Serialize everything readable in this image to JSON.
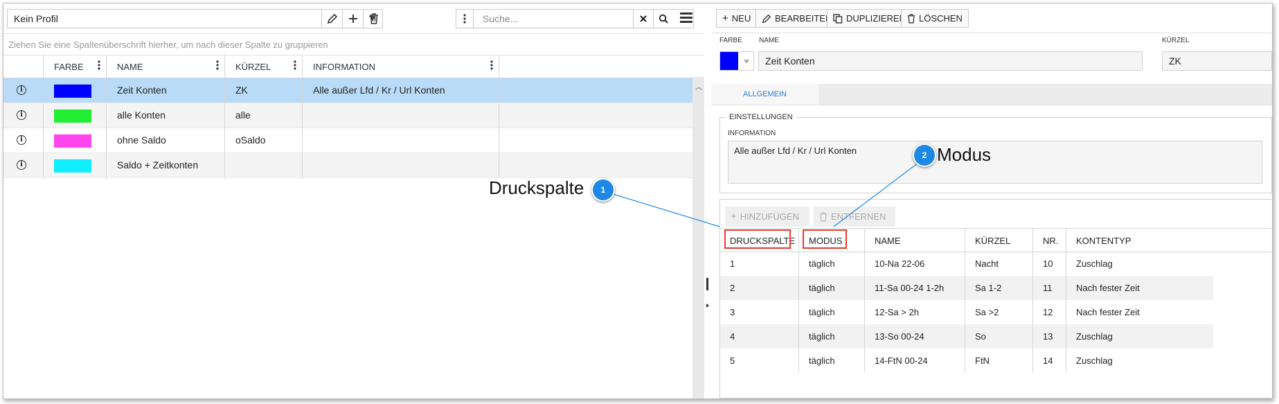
{
  "left": {
    "profile_select": "Kein Profil",
    "search_placeholder": "Suche...",
    "group_hint": "Ziehen Sie eine Spaltenüberschrift hierher, um nach dieser Spalte zu gruppieren",
    "columns": [
      "FARBE",
      "NAME",
      "KÜRZEL",
      "INFORMATION"
    ],
    "rows": [
      {
        "color": "#0000ff",
        "name": "Zeit Konten",
        "short": "ZK",
        "info": "Alle außer Lfd / Kr / Url Konten",
        "selected": true
      },
      {
        "color": "#22ee33",
        "name": "alle Konten",
        "short": "alle",
        "info": ""
      },
      {
        "color": "#ff44ee",
        "name": "ohne Saldo",
        "short": "oSaldo",
        "info": ""
      },
      {
        "color": "#11eeff",
        "name": "Saldo + Zeitkonten",
        "short": "",
        "info": ""
      }
    ]
  },
  "right": {
    "actions": {
      "new": "NEU",
      "edit": "BEARBEITEN",
      "duplicate": "DUPLIZIEREN",
      "delete": "LÖSCHEN"
    },
    "form": {
      "color_label": "FARBE",
      "color_value": "#0000ff",
      "name_label": "NAME",
      "name_value": "Zeit Konten",
      "short_label": "KÜRZEL",
      "short_value": "ZK"
    },
    "tab": "ALLGEMEIN",
    "settings": {
      "legend": "EINSTELLUNGEN",
      "info_label": "INFORMATION",
      "info_value": "Alle außer Lfd / Kr / Url Konten"
    },
    "sub_actions": {
      "add": "HINZUFÜGEN",
      "remove": "ENTFERNEN"
    },
    "sub_columns": [
      "DRUCKSPALTE",
      "MODUS",
      "NAME",
      "KÜRZEL",
      "NR.",
      "KONTENTYP"
    ],
    "sub_rows": [
      [
        "1",
        "täglich",
        "10-Na 22-06",
        "Nacht",
        "10",
        "Zuschlag"
      ],
      [
        "2",
        "täglich",
        "11-Sa 00-24 1-2h",
        "Sa 1-2",
        "11",
        "Nach fester Zeit"
      ],
      [
        "3",
        "täglich",
        "12-Sa > 2h",
        "Sa >2",
        "12",
        "Nach fester Zeit"
      ],
      [
        "4",
        "täglich",
        "13-So 00-24",
        "So",
        "13",
        "Zuschlag"
      ],
      [
        "5",
        "täglich",
        "14-FtN 00-24",
        "FtN",
        "14",
        "Zuschlag"
      ]
    ]
  },
  "callouts": [
    {
      "number": "1",
      "label": "Druckspalte"
    },
    {
      "number": "2",
      "label": "Modus"
    }
  ]
}
